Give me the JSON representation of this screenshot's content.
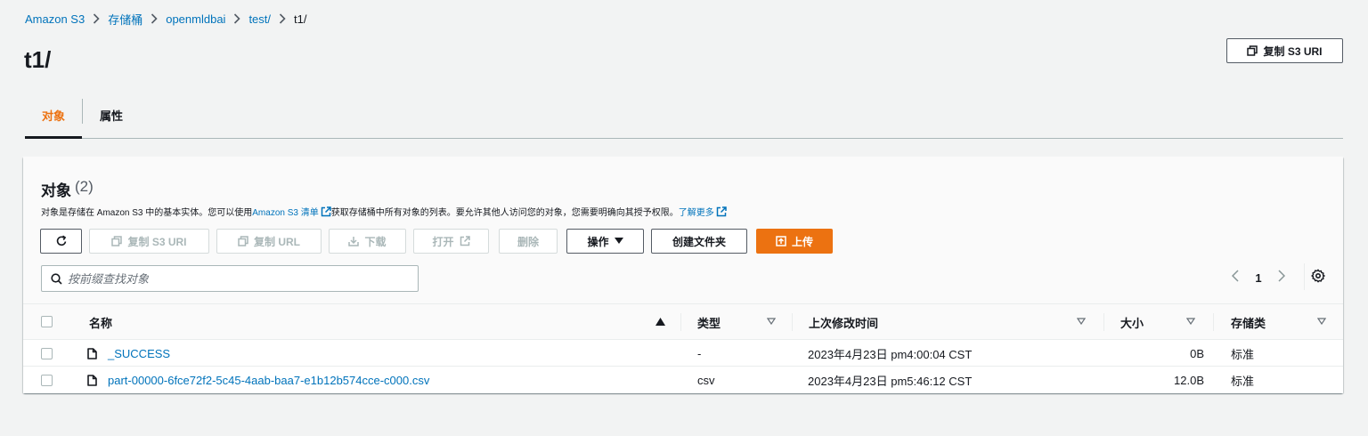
{
  "breadcrumb": {
    "items": [
      "Amazon S3",
      "存储桶",
      "openmldbai",
      "test/"
    ],
    "current": "t1/"
  },
  "page_title": "t1/",
  "copy_uri_top_label": "复制 S3 URI",
  "tabs": [
    {
      "label": "对象",
      "active": true
    },
    {
      "label": "属性",
      "active": false
    }
  ],
  "objects_panel": {
    "title": "对象",
    "count": "(2)",
    "desc_part1": "对象是存储在 Amazon S3 中的基本实体。您可以使用 ",
    "inventory_link": "Amazon S3 清单",
    "desc_part2": "获取存储桶中所有对象的列表。要允许其他人访问您的对象，您需要明确向其授予权限。",
    "learn_more": "了解更多"
  },
  "toolbar": {
    "copy_s3_uri": "复制 S3 URI",
    "copy_url": "复制 URL",
    "download": "下载",
    "open": "打开",
    "delete": "删除",
    "actions": "操作",
    "create_folder": "创建文件夹",
    "upload": "上传"
  },
  "search": {
    "placeholder": "按前缀查找对象",
    "value": ""
  },
  "pagination": {
    "current_page": "1"
  },
  "table": {
    "columns": {
      "name": "名称",
      "type": "类型",
      "last_modified": "上次修改时间",
      "size": "大小",
      "storage_class": "存储类"
    },
    "rows": [
      {
        "name": "_SUCCESS",
        "type": "-",
        "last_modified": "2023年4月23日 pm4:00:04 CST",
        "size": "0B",
        "storage_class": "标准"
      },
      {
        "name": "part-00000-6fce72f2-5c45-4aab-baa7-e1b12b574cce-c000.csv",
        "type": "csv",
        "last_modified": "2023年4月23日 pm5:46:12 CST",
        "size": "12.0B",
        "storage_class": "标准"
      }
    ]
  },
  "colors": {
    "accent": "#ec7211",
    "link": "#0073bb",
    "text": "#16191f",
    "disabled": "#aab7b8"
  }
}
